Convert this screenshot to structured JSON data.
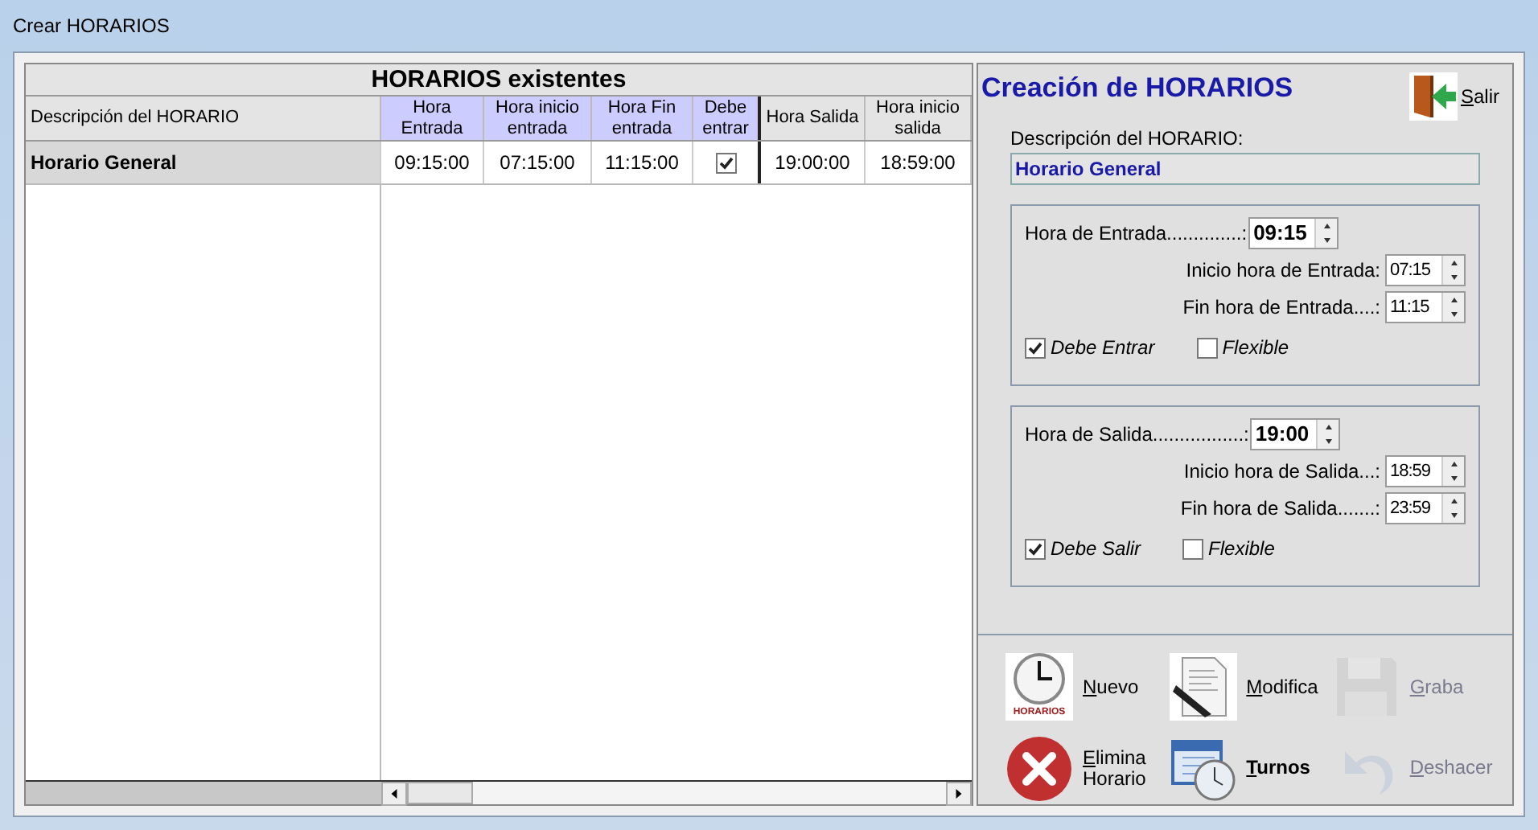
{
  "window": {
    "title": "Crear HORARIOS"
  },
  "grid": {
    "title": "HORARIOS existentes",
    "columns": [
      {
        "label": "Descripción del HORARIO",
        "highlighted": false
      },
      {
        "label": "Hora Entrada",
        "highlighted": true
      },
      {
        "label": "Hora inicio entrada",
        "highlighted": true
      },
      {
        "label": "Hora Fin entrada",
        "highlighted": true
      },
      {
        "label": "Debe entrar",
        "highlighted": true
      },
      {
        "label": "Hora Salida",
        "highlighted": false
      },
      {
        "label": "Hora inicio salida",
        "highlighted": false
      }
    ],
    "rows": [
      {
        "cells": [
          {
            "kind": "text",
            "text": "Horario General"
          },
          {
            "kind": "text",
            "text": "09:15:00"
          },
          {
            "kind": "text",
            "text": "07:15:00"
          },
          {
            "kind": "text",
            "text": "11:15:00"
          },
          {
            "kind": "check",
            "checked": true
          },
          {
            "kind": "text",
            "text": "19:00:00"
          },
          {
            "kind": "text",
            "text": "18:59:00"
          }
        ]
      }
    ]
  },
  "editor": {
    "title": "Creación de HORARIOS",
    "exit_button": "Salir",
    "description_label": "Descripción del HORARIO:",
    "description_value": "Horario General",
    "sections": [
      {
        "main_label": "Hora de Entrada..............:",
        "main_value": "09:15",
        "times": [
          {
            "label": "Inicio hora de Entrada:",
            "value": "07:15"
          },
          {
            "label": "Fin hora de Entrada....:",
            "value": "11:15"
          }
        ],
        "checks": [
          {
            "label": "Debe Entrar",
            "checked": true
          },
          {
            "label": "Flexible",
            "checked": false
          }
        ]
      },
      {
        "main_label": "Hora de Salida.................:",
        "main_value": "19:00",
        "times": [
          {
            "label": "Inicio hora de Salida...:",
            "value": "18:59"
          },
          {
            "label": "Fin hora de Salida.......:",
            "value": "23:59"
          }
        ],
        "checks": [
          {
            "label": "Debe Salir",
            "checked": true
          },
          {
            "label": "Flexible",
            "checked": false
          }
        ]
      }
    ]
  },
  "actions": [
    {
      "kind": "clock",
      "label": "Nuevo",
      "icon_caption": "HORARIOS",
      "disabled": false,
      "bold": false
    },
    {
      "kind": "document",
      "label": "Modifica",
      "disabled": false,
      "bold": false
    },
    {
      "kind": "floppy",
      "label": "Graba",
      "disabled": true,
      "bold": false
    },
    {
      "kind": "delete",
      "label": "Elimina Horario",
      "disabled": false,
      "bold": false
    },
    {
      "kind": "calendar",
      "label": "Turnos",
      "disabled": false,
      "bold": true
    },
    {
      "kind": "undo",
      "label": "Deshacer",
      "disabled": true,
      "bold": false
    }
  ]
}
